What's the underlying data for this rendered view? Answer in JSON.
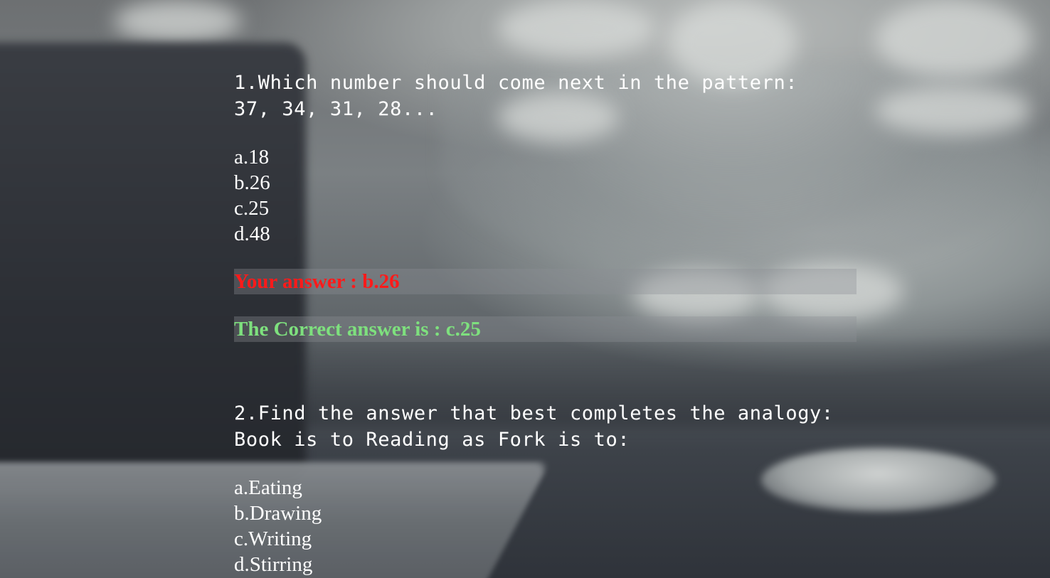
{
  "questions": [
    {
      "question_line1": "1.Which number should come next in the pattern:",
      "question_line2": "37, 34, 31, 28...",
      "options": [
        "a.18",
        "b.26",
        "c.25",
        "d.48"
      ],
      "your_answer": "Your answer : b.26",
      "correct_answer": "The Correct answer is : c.25"
    },
    {
      "question_line1": "2.Find the answer that best completes the analogy:",
      "question_line2": "Book is to Reading as Fork is to:",
      "options": [
        "a.Eating",
        "b.Drawing",
        "c.Writing",
        "d.Stirring"
      ]
    }
  ],
  "colors": {
    "your_answer": "#ff1a1a",
    "correct_answer": "#7ee07e",
    "text": "#ffffff"
  }
}
